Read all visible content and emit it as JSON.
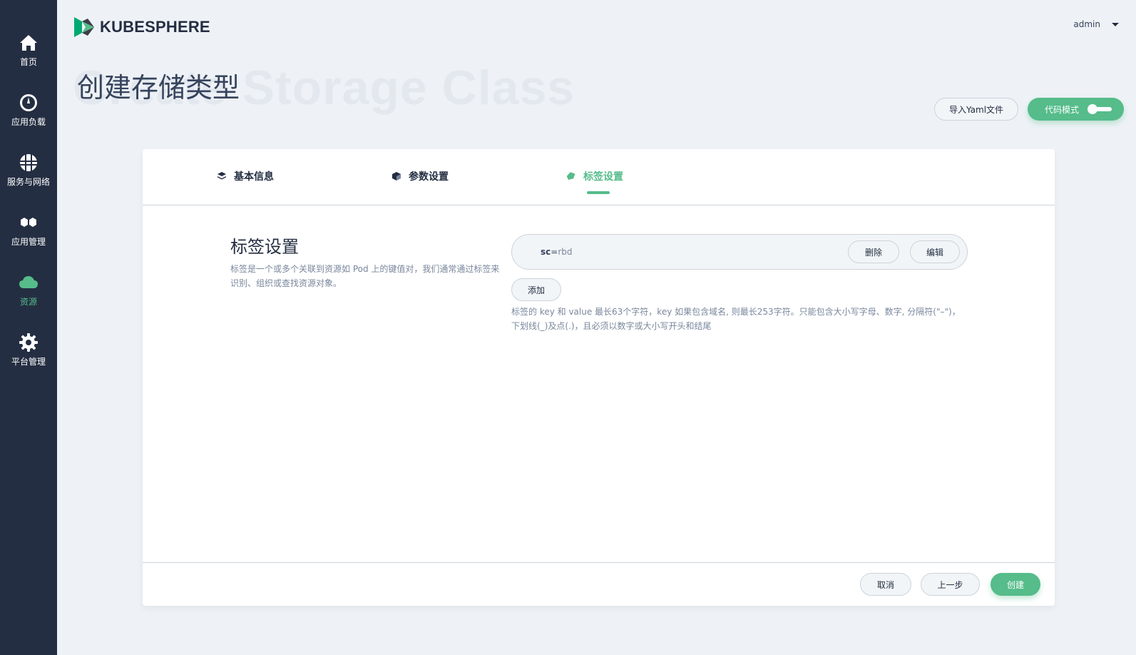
{
  "sidebar": {
    "items": [
      {
        "label": "首页",
        "icon": "home-icon"
      },
      {
        "label": "应用负载",
        "icon": "dashboard-icon"
      },
      {
        "label": "服务与网络",
        "icon": "network-globe-icon"
      },
      {
        "label": "应用管理",
        "icon": "hexagons-icon"
      },
      {
        "label": "资源",
        "icon": "cloud-icon",
        "active": true
      },
      {
        "label": "平台管理",
        "icon": "gear-icon"
      }
    ]
  },
  "header": {
    "logo_text": "KUBESPHERE",
    "user": "admin"
  },
  "page": {
    "title": "创建存储类型",
    "background_title": "Create Storage Class",
    "import_yaml_label": "导入Yaml文件",
    "code_mode_label": "代码模式"
  },
  "steps": [
    {
      "label": "基本信息",
      "icon": "layers-icon"
    },
    {
      "label": "参数设置",
      "icon": "cube-icon"
    },
    {
      "label": "标签设置",
      "icon": "tag-icon",
      "active": true
    }
  ],
  "labels_section": {
    "title": "标签设置",
    "description": "标签是一个或多个关联到资源如 Pod 上的键值对，我们通常通过标签来识别、组织或查找资源对象。",
    "labels": [
      {
        "key": "sc",
        "value": "rbd"
      }
    ],
    "delete_label": "删除",
    "edit_label": "编辑",
    "add_label": "添加",
    "hint": "标签的 key 和 value 最长63个字符，key 如果包含域名, 则最长253字符。只能包含大小写字母、数字, 分隔符(\"–\")，下划线(_)及点(.)，且必须以数字或大小写开头和结尾"
  },
  "footer": {
    "cancel_label": "取消",
    "prev_label": "上一步",
    "create_label": "创建"
  },
  "colors": {
    "sidebar_bg": "#242e42",
    "accent": "#55bc8a",
    "page_bg": "#eef2f6"
  }
}
